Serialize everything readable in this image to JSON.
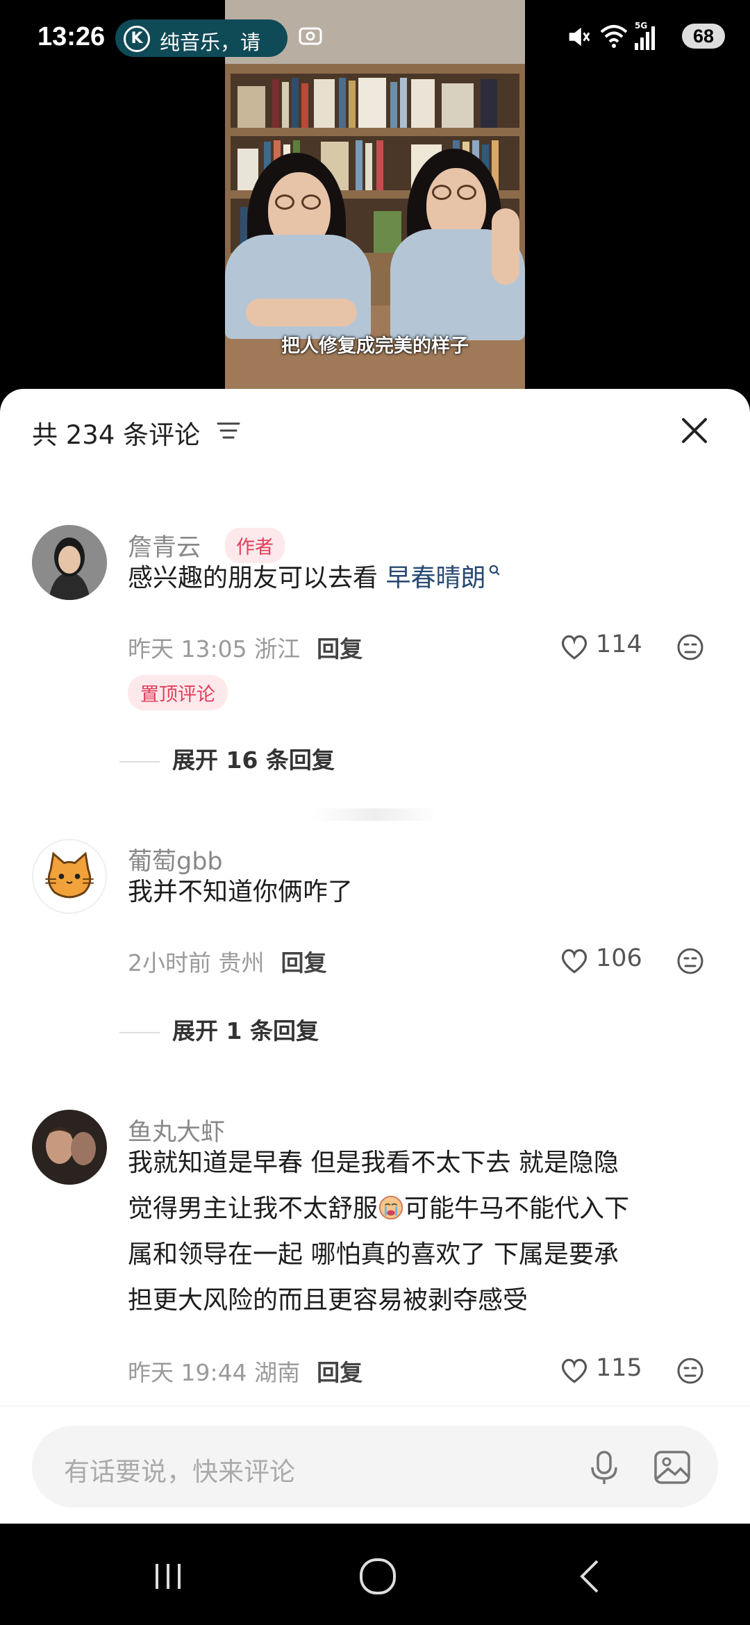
{
  "status_bar": {
    "time": "13:26",
    "music_notice": "纯音乐，请",
    "music_app_letter": "K",
    "battery": "68",
    "network_label": "5G"
  },
  "video": {
    "caption": "把人修复成完美的样子"
  },
  "comments_panel": {
    "title": "共 234 条评论",
    "comments": [
      {
        "username": "詹青云",
        "author_tag": "作者",
        "text_prefix": "感兴趣的朋友可以去看 ",
        "text_link": "早春晴朗",
        "time_location": "昨天 13:05 浙江",
        "reply_label": "回复",
        "likes": "114",
        "pinned_label": "置顶评论",
        "expand_label": "展开 16 条回复"
      },
      {
        "username": "葡萄gbb",
        "text": "我并不知道你俩咋了",
        "time_location": "2小时前 贵州",
        "reply_label": "回复",
        "likes": "106",
        "expand_label": "展开 1 条回复"
      },
      {
        "username": "鱼丸大虾",
        "text_line1": "我就知道是早春 但是我看不太下去 就是隐隐",
        "text_line2a": "觉得男主让我不太舒服",
        "text_line2b": "可能牛马不能代入下",
        "text_line3": "属和领导在一起 哪怕真的喜欢了 下属是要承",
        "text_line4": "担更大风险的而且更容易被剥夺感受",
        "time_location": "昨天 19:44 湖南",
        "reply_label": "回复",
        "likes": "115"
      }
    ]
  },
  "input_bar": {
    "placeholder": "有话要说，快来评论"
  },
  "colors": {
    "accent_pink": "#e23e5a",
    "link_blue": "#284a72",
    "music_pill": "#0f4a57"
  }
}
